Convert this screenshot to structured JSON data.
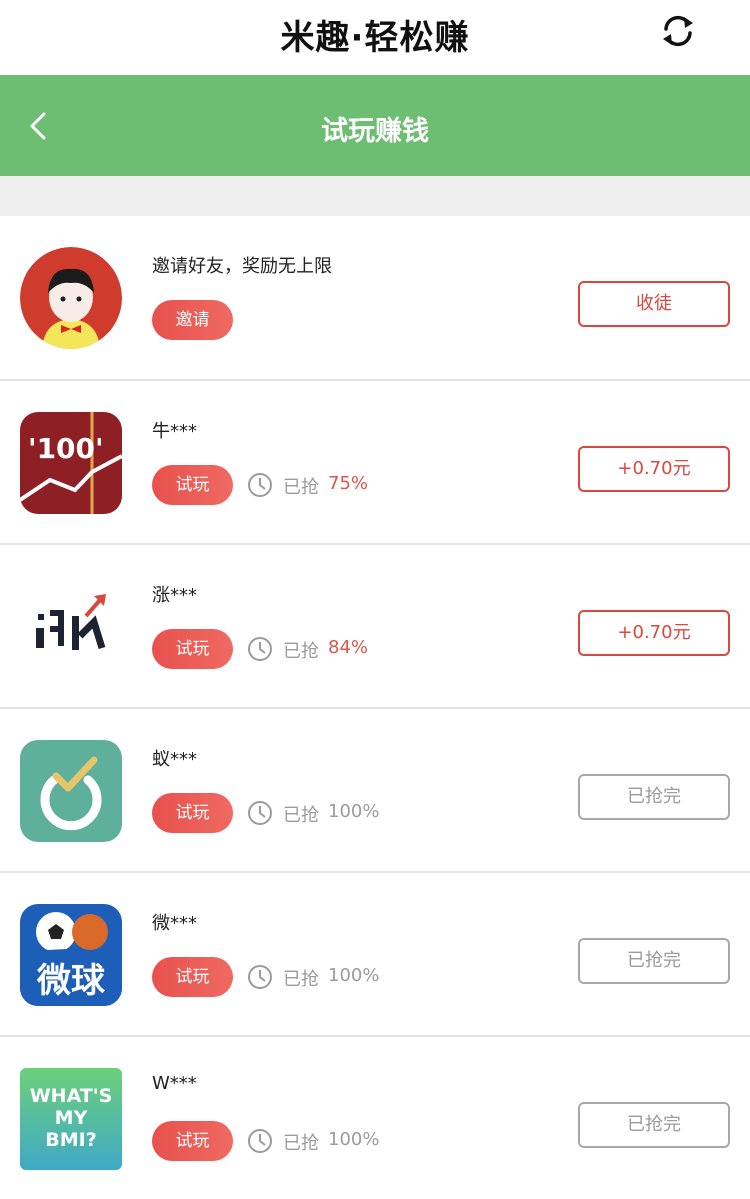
{
  "app_title": "米趣·轻松赚",
  "nav": {
    "title": "试玩赚钱"
  },
  "colors": {
    "green": "#6dbd73",
    "red": "#e0544c",
    "gray": "#9b9b9b"
  },
  "invite": {
    "title": "邀请好友，奖励无上限",
    "pill": "邀请",
    "action": "收徒"
  },
  "tasks": [
    {
      "name": "牛***",
      "pill": "试玩",
      "grabbed_label": "已抢",
      "percent": "75%",
      "action": "+0.70元",
      "icon": "niu-100-app-icon"
    },
    {
      "name": "涨***",
      "pill": "试玩",
      "grabbed_label": "已抢",
      "percent": "84%",
      "action": "+0.70元",
      "icon": "zhang-app-icon"
    },
    {
      "name": "蚁***",
      "pill": "试玩",
      "grabbed_label": "已抢",
      "percent": "100%",
      "action": "已抢完",
      "icon": "ant-app-icon"
    },
    {
      "name": "微***",
      "pill": "试玩",
      "grabbed_label": "已抢",
      "percent": "100%",
      "action": "已抢完",
      "icon": "weiqiu-app-icon",
      "icon_text": "微球"
    },
    {
      "name": "W***",
      "pill": "试玩",
      "grabbed_label": "已抢",
      "percent": "100%",
      "action": "已抢完",
      "icon": "bmi-app-icon",
      "icon_text": "WHAT'S MY BMI?"
    }
  ]
}
